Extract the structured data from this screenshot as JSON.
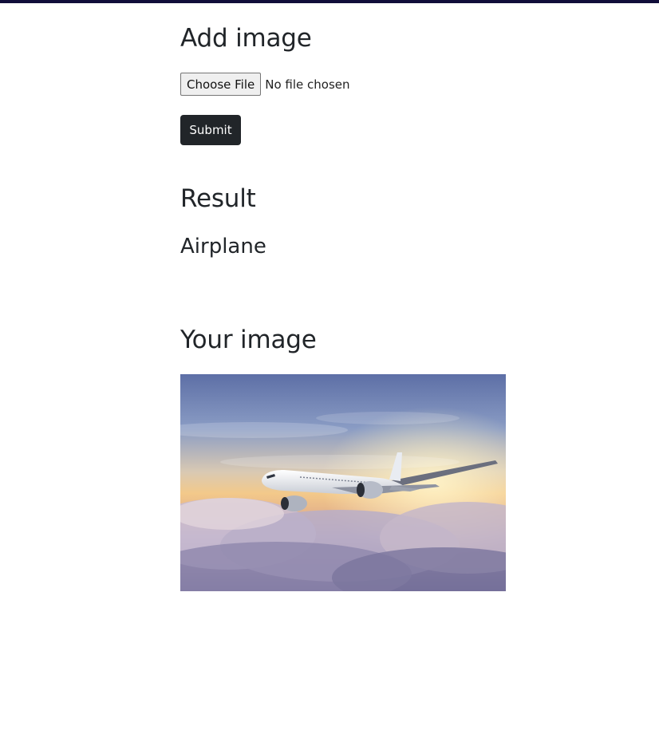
{
  "add_section": {
    "title": "Add image",
    "file_input": {
      "button_label": "Choose File",
      "status_text": "No file chosen"
    },
    "submit_label": "Submit"
  },
  "result_section": {
    "title": "Result",
    "value": "Airplane"
  },
  "image_section": {
    "title": "Your image",
    "image_subject": "airplane-above-clouds-photo"
  },
  "colors": {
    "top_strip": "#100d3a",
    "text": "#212529",
    "submit_bg": "#212529",
    "submit_text": "#ffffff"
  }
}
